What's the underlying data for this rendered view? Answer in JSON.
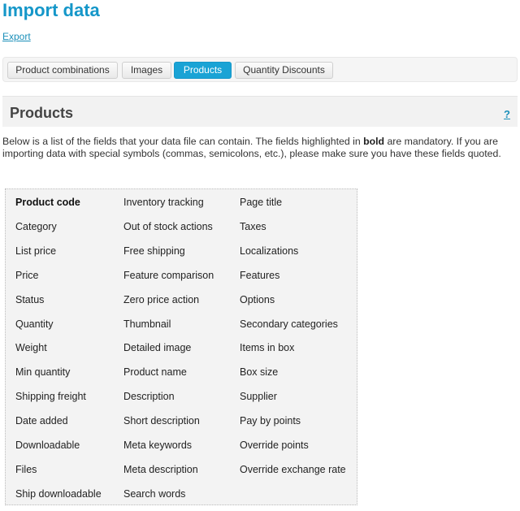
{
  "header": {
    "title": "Import data",
    "export_link": "Export"
  },
  "tabs": [
    {
      "label": "Product combinations",
      "active": false
    },
    {
      "label": "Images",
      "active": false
    },
    {
      "label": "Products",
      "active": true
    },
    {
      "label": "Quantity Discounts",
      "active": false
    }
  ],
  "section": {
    "title": "Products",
    "help_label": "?"
  },
  "description": {
    "before_bold": "Below is a list of the fields that your data file can contain. The fields highlighted in ",
    "bold_word": "bold",
    "after_bold": " are mandatory. If you are importing data with special symbols (commas, semicolons, etc.), please make sure you have these fields quoted."
  },
  "fields": {
    "columns": [
      [
        {
          "label": "Product code",
          "mandatory": true
        },
        {
          "label": "Category",
          "mandatory": false
        },
        {
          "label": "List price",
          "mandatory": false
        },
        {
          "label": "Price",
          "mandatory": false
        },
        {
          "label": "Status",
          "mandatory": false
        },
        {
          "label": "Quantity",
          "mandatory": false
        },
        {
          "label": "Weight",
          "mandatory": false
        },
        {
          "label": "Min quantity",
          "mandatory": false
        },
        {
          "label": "Shipping freight",
          "mandatory": false
        },
        {
          "label": "Date added",
          "mandatory": false
        },
        {
          "label": "Downloadable",
          "mandatory": false
        },
        {
          "label": "Files",
          "mandatory": false
        },
        {
          "label": "Ship downloadable",
          "mandatory": false
        }
      ],
      [
        {
          "label": "Inventory tracking",
          "mandatory": false
        },
        {
          "label": "Out of stock actions",
          "mandatory": false
        },
        {
          "label": "Free shipping",
          "mandatory": false
        },
        {
          "label": "Feature comparison",
          "mandatory": false
        },
        {
          "label": "Zero price action",
          "mandatory": false
        },
        {
          "label": "Thumbnail",
          "mandatory": false
        },
        {
          "label": "Detailed image",
          "mandatory": false
        },
        {
          "label": "Product name",
          "mandatory": false
        },
        {
          "label": "Description",
          "mandatory": false
        },
        {
          "label": "Short description",
          "mandatory": false
        },
        {
          "label": "Meta keywords",
          "mandatory": false
        },
        {
          "label": "Meta description",
          "mandatory": false
        },
        {
          "label": "Search words",
          "mandatory": false
        }
      ],
      [
        {
          "label": "Page title",
          "mandatory": false
        },
        {
          "label": "Taxes",
          "mandatory": false
        },
        {
          "label": "Localizations",
          "mandatory": false
        },
        {
          "label": "Features",
          "mandatory": false
        },
        {
          "label": "Options",
          "mandatory": false
        },
        {
          "label": "Secondary categories",
          "mandatory": false
        },
        {
          "label": "Items in box",
          "mandatory": false
        },
        {
          "label": "Box size",
          "mandatory": false
        },
        {
          "label": "Supplier",
          "mandatory": false
        },
        {
          "label": "Pay by points",
          "mandatory": false
        },
        {
          "label": "Override points",
          "mandatory": false
        },
        {
          "label": "Override exchange rate",
          "mandatory": false
        }
      ]
    ]
  },
  "colors": {
    "accent": "#1597c9",
    "active_tab": "#1aa3d5",
    "link": "#1b8fb9",
    "fields_background": "#f3f3f3",
    "section_header_background": "#f2f2f2"
  }
}
